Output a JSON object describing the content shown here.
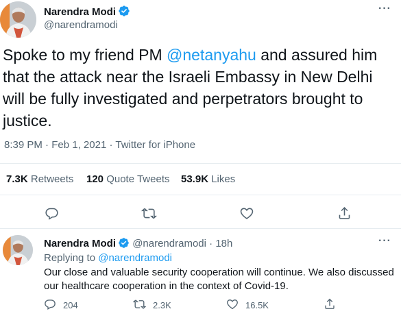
{
  "main_tweet": {
    "author_name": "Narendra Modi",
    "handle": "@narendramodi",
    "text_before": "Spoke to my friend PM ",
    "mention": "@netanyahu",
    "text_after": " and assured him that the attack near the Israeli Embassy in New Delhi will be fully investigated and perpetrators brought to justice.",
    "time": "8:39 PM",
    "date": "Feb 1, 2021",
    "separator": "·",
    "source": "Twitter for iPhone",
    "retweets_count": "7.3K",
    "retweets_label": "Retweets",
    "quote_count": "120",
    "quote_label": "Quote Tweets",
    "likes_count": "53.9K",
    "likes_label": "Likes"
  },
  "reply_tweet": {
    "author_name": "Narendra Modi",
    "handle": "@narendramodi",
    "separator": "·",
    "age": "18h",
    "replying_label": "Replying to",
    "replying_to": "@narendramodi",
    "text": "Our close and valuable security cooperation will continue. We also discussed our healthcare cooperation in the context of Covid-19.",
    "reply_count": "204",
    "retweet_count": "2.3K",
    "like_count": "16.5K"
  },
  "icons": {
    "verified": "verified-badge-icon",
    "more": "more-options-icon",
    "reply": "reply-icon",
    "retweet": "retweet-icon",
    "like": "heart-icon",
    "share": "share-icon"
  },
  "colors": {
    "accent": "#1d9bf0",
    "text": "#0f1419",
    "muted": "#536471",
    "divider": "#e6ecf0"
  }
}
